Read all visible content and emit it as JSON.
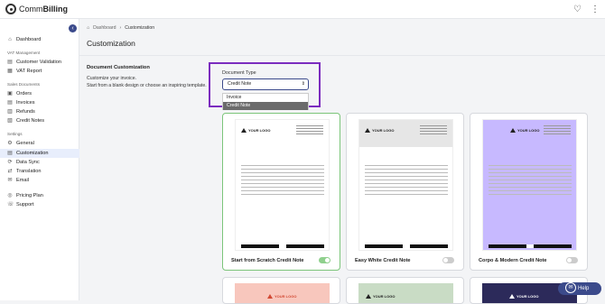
{
  "app": {
    "name_prefix": "Comm",
    "name_suffix": "Billing"
  },
  "colors": {
    "accent": "#3b4a8b",
    "highlight": "#7b2cbf",
    "active_nav": "#e8eefc",
    "toggle_on": "#8fd08d"
  },
  "sidebar": {
    "dashboard": "Dashboard",
    "vat_section": "VAT Management",
    "customer_validation": "Customer Validation",
    "vat_report": "VAT Report",
    "sales_section": "Sales Documents",
    "orders": "Orders",
    "invoices": "Invoices",
    "refunds": "Refunds",
    "credit_notes": "Credit Notes",
    "settings_section": "Settings",
    "general": "General",
    "customization": "Customization",
    "data_sync": "Data Sync",
    "translation": "Translation",
    "email": "Email",
    "pricing_plan": "Pricing Plan",
    "support": "Support"
  },
  "breadcrumb": {
    "home": "Dashboard",
    "current": "Customization"
  },
  "page": {
    "title": "Customization"
  },
  "doc": {
    "title": "Document Customization",
    "desc1": "Customize your invoice.",
    "desc2": "Start from a blank design or choose an inspiring template."
  },
  "document_type": {
    "label": "Document Type",
    "selected": "Credit Note",
    "options": [
      "Invoice",
      "Credit Note"
    ]
  },
  "templates": [
    {
      "name": "Start from Scratch Credit Note",
      "enabled": true,
      "logo_text": "YOUR LOGO"
    },
    {
      "name": "Easy White Credit Note",
      "enabled": false,
      "logo_text": "YOUR LOGO"
    },
    {
      "name": "Corpo & Modern Credit Note",
      "enabled": false,
      "logo_text": "YOUR LOGO"
    }
  ],
  "bottom_templates": [
    {
      "logo_text": "YOUR LOGO"
    },
    {
      "logo_text": "YOUR LOGO"
    },
    {
      "logo_text": "YOUR LOGO"
    }
  ],
  "help": {
    "label": "Help"
  }
}
